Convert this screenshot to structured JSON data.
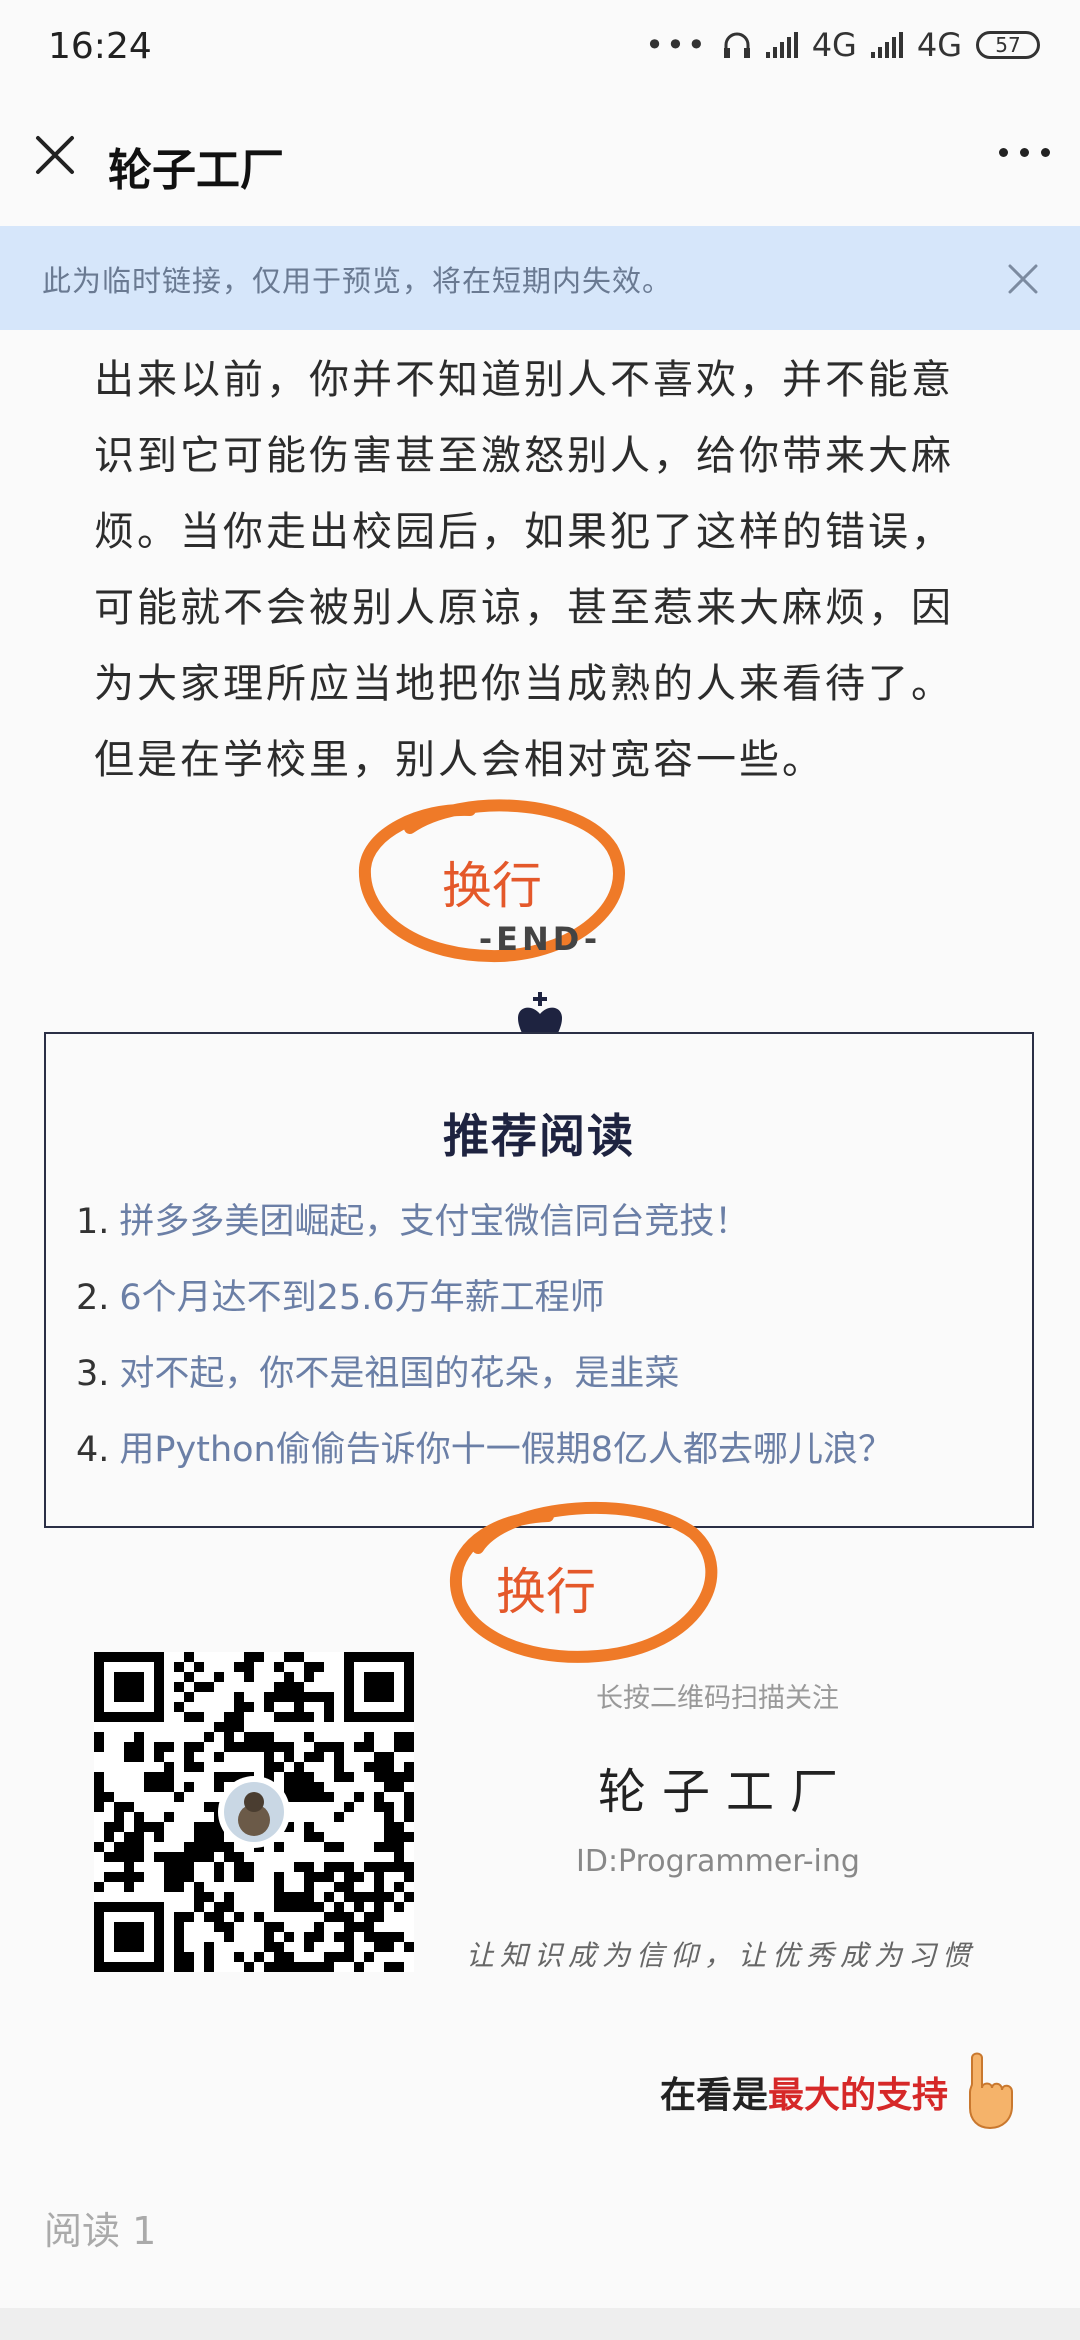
{
  "status_bar": {
    "time": "16:24",
    "network_1": "4G",
    "network_2": "4G",
    "battery": "57"
  },
  "nav": {
    "title": "轮子工厂"
  },
  "banner": {
    "text": "此为临时链接，仅用于预览，将在短期内失效。"
  },
  "article": {
    "lines": [
      "出来以前，你并不知道别人不喜欢，并不能意",
      "识到它可能伤害甚至激怒别人，给你带来大麻",
      "烦。当你走出校园后，如果犯了这样的错误，",
      "可能就不会被别人原谅，甚至惹来大麻烦，因",
      "为大家理所应当地把你当成熟的人来看待了。",
      "但是在学校里，别人会相对宽容一些。"
    ],
    "end_label": "-END-"
  },
  "annotations": {
    "mark_1": "换行",
    "mark_2": "换行",
    "mark_color": "#e4582a"
  },
  "recommend": {
    "title": "推荐阅读",
    "items": [
      {
        "num": "1.",
        "text": "拼多多美团崛起，支付宝微信同台竞技！"
      },
      {
        "num": "2.",
        "text": "6个月达不到25.6万年薪工程师"
      },
      {
        "num": "3.",
        "text": "对不起，你不是祖国的花朵，是韭菜"
      },
      {
        "num": "4.",
        "text": "用Python偷偷告诉你十一假期8亿人都去哪儿浪？"
      }
    ]
  },
  "qr_section": {
    "caption": "长按二维码扫描关注",
    "name": "轮子工厂",
    "id": "ID:Programmer-ing",
    "slogan": "让知识成为信仰，让优秀成为习惯"
  },
  "support": {
    "part1": "在看是",
    "part2": "最大的支持"
  },
  "footer": {
    "read_count": "阅读 1"
  }
}
